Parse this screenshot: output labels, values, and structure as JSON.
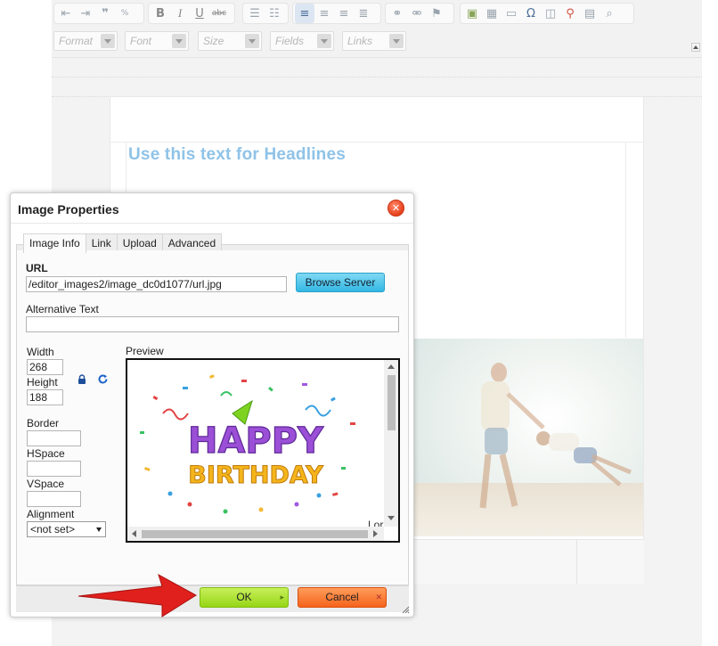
{
  "toolbar": {
    "format_placeholder": "Format",
    "font_placeholder": "Font",
    "size_placeholder": "Size",
    "fields_placeholder": "Fields",
    "links_placeholder": "Links",
    "strike_label": "abc",
    "bold_label": "B",
    "italic_label": "I",
    "underline_label": "U"
  },
  "document": {
    "headline": "Use this text for Headlines"
  },
  "dialog": {
    "title": "Image Properties",
    "tabs": [
      "Image Info",
      "Link",
      "Upload",
      "Advanced"
    ],
    "url_label": "URL",
    "url_value": "/editor_images2/image_dc0d1077/url.jpg",
    "browse_button": "Browse Server",
    "alt_label": "Alternative Text",
    "alt_value": "",
    "width_label": "Width",
    "width_value": "268",
    "height_label": "Height",
    "height_value": "188",
    "border_label": "Border",
    "border_value": "",
    "hspace_label": "HSpace",
    "hspace_value": "",
    "vspace_label": "VSpace",
    "vspace_value": "",
    "alignment_label": "Alignment",
    "alignment_value": "<not set>",
    "preview_label": "Preview",
    "preview_overflow_text": "Lor",
    "preview_image_line1": "HAPPY",
    "preview_image_line2": "BIRTHDAY",
    "ok_button": "OK",
    "cancel_button": "Cancel"
  },
  "colors": {
    "headline": "#8fc3e8",
    "ok_green": "#96d616",
    "cancel_orange": "#f5631c",
    "browse_blue": "#33b8e4",
    "arrow_red": "#e0201c"
  }
}
